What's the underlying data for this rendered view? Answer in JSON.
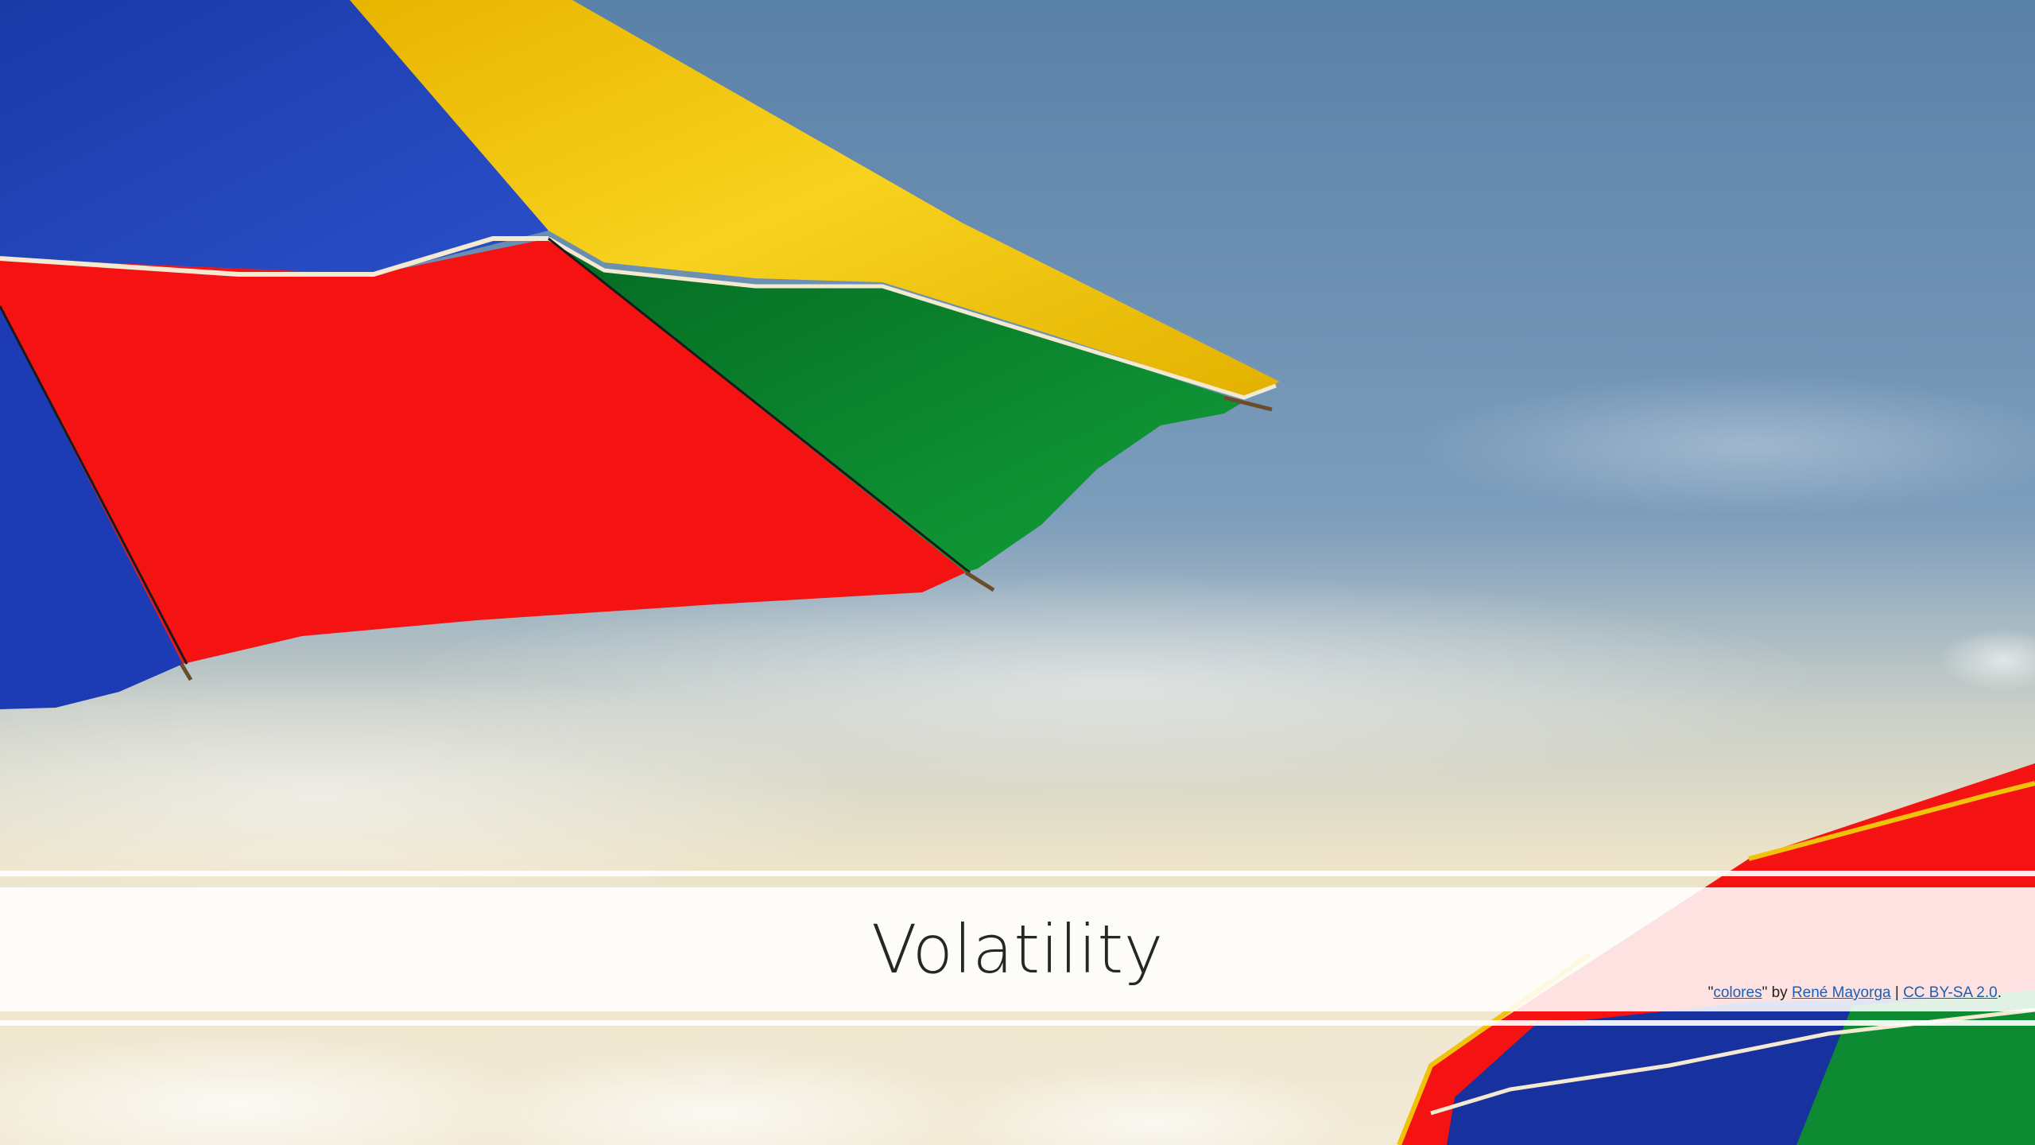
{
  "slide": {
    "title": "Volatility"
  },
  "attribution": {
    "open_quote": "\"",
    "photo_title": "colores",
    "by_text": "\" by ",
    "author": "René Mayorga",
    "separator": " | ",
    "license": "CC BY-SA 2.0",
    "end": "."
  },
  "colors": {
    "umbrella_blue": "#1f3fb0",
    "umbrella_yellow": "#f2c20a",
    "umbrella_red": "#f41010",
    "umbrella_green": "#0a7a2a",
    "sky_top": "#5f86ab",
    "sky_bottom": "#efe6cf"
  }
}
